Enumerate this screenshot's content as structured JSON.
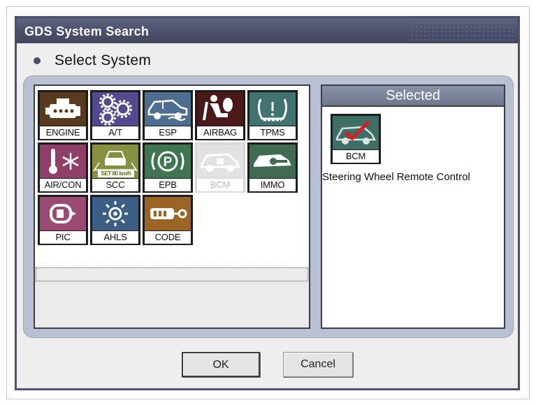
{
  "dialog": {
    "title": "GDS System Search",
    "heading": "Select System"
  },
  "systems": [
    {
      "label": "ENGINE",
      "icon": "engine-icon",
      "color": "#5a3a1e",
      "enabled": true
    },
    {
      "label": "A/T",
      "icon": "gears-icon",
      "color": "#56488d",
      "enabled": true
    },
    {
      "label": "ESP",
      "icon": "esp-car-icon",
      "color": "#4e6e8f",
      "enabled": true
    },
    {
      "label": "AIRBAG",
      "icon": "airbag-icon",
      "color": "#4a1818",
      "enabled": true
    },
    {
      "label": "TPMS",
      "icon": "tire-pressure-icon",
      "color": "#3f7270",
      "enabled": true
    },
    {
      "label": "AIR/CON",
      "icon": "thermometer-snowflake-icon",
      "color": "#8e4068",
      "enabled": true
    },
    {
      "label": "SCC",
      "icon": "cruise-control-icon",
      "color": "#86903e",
      "enabled": true
    },
    {
      "label": "EPB",
      "icon": "parking-brake-icon",
      "color": "#3f7550",
      "enabled": true
    },
    {
      "label": "BCM",
      "icon": "body-control-icon",
      "color": "#d4d4d4",
      "enabled": false
    },
    {
      "label": "IMMO",
      "icon": "key-car-icon",
      "color": "#3e6b52",
      "enabled": true
    },
    {
      "label": "PIC",
      "icon": "smart-key-icon",
      "color": "#9a4a73",
      "enabled": true
    },
    {
      "label": "AHLS",
      "icon": "headlight-icon",
      "color": "#3c5d84",
      "enabled": true
    },
    {
      "label": "CODE",
      "icon": "code-key-icon",
      "color": "#9a6424",
      "enabled": true
    }
  ],
  "scc_sign_text": "SET 80 km/h",
  "selected_panel": {
    "header": "Selected",
    "item_label": "BCM",
    "item_icon": "bcm-checkmark-icon",
    "item_color": "#3f6e66",
    "description": "Steering Wheel Remote Control"
  },
  "buttons": {
    "ok": "OK",
    "cancel": "Cancel"
  }
}
